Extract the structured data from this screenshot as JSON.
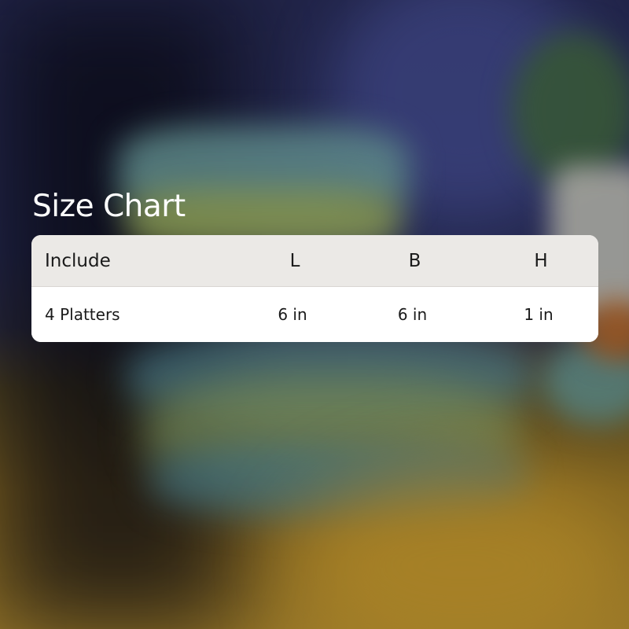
{
  "title": "Size Chart",
  "table": {
    "headers": [
      "Include",
      "L",
      "B",
      "H"
    ],
    "rows": [
      [
        "4 Platters",
        "6 in",
        "6 in",
        "1 in"
      ]
    ]
  },
  "colors": {
    "header_bg": "#ebe9e6",
    "body_bg": "#ffffff",
    "title_color": "#ffffff"
  }
}
